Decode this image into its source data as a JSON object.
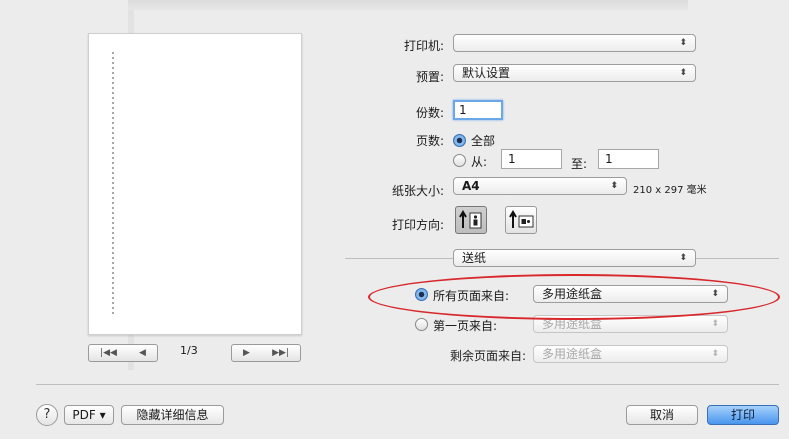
{
  "printer": {
    "label": "打印机:",
    "value": ""
  },
  "preset": {
    "label": "预置:",
    "value": "默认设置"
  },
  "copies": {
    "label": "份数:",
    "value": "1"
  },
  "pages": {
    "label": "页数:",
    "all_label": "全部",
    "from_label": "从:",
    "from_value": "1",
    "to_label": "至:",
    "to_value": "1"
  },
  "paper_size": {
    "label": "纸张大小:",
    "value": "A4",
    "dimensions": "210 x 297 毫米"
  },
  "orientation": {
    "label": "打印方向:"
  },
  "section_menu": {
    "value": "送纸"
  },
  "feed": {
    "all_pages_label": "所有页面来自:",
    "all_pages_value": "多用途纸盒",
    "first_page_label": "第一页来自:",
    "first_page_value": "多用途纸盒",
    "remaining_label": "剩余页面来自:",
    "remaining_value": "多用途纸盒"
  },
  "preview": {
    "page_indicator": "1/3",
    "nav_first": "|◀◀",
    "nav_prev": "◀",
    "nav_next": "▶",
    "nav_last": "▶▶|"
  },
  "footer": {
    "help": "?",
    "pdf_label": "PDF ▾",
    "hide_details": "隐藏详细信息",
    "cancel": "取消",
    "print": "打印"
  },
  "colors": {
    "highlight_ellipse": "#d8282c",
    "default_button": "#4a95ee"
  }
}
